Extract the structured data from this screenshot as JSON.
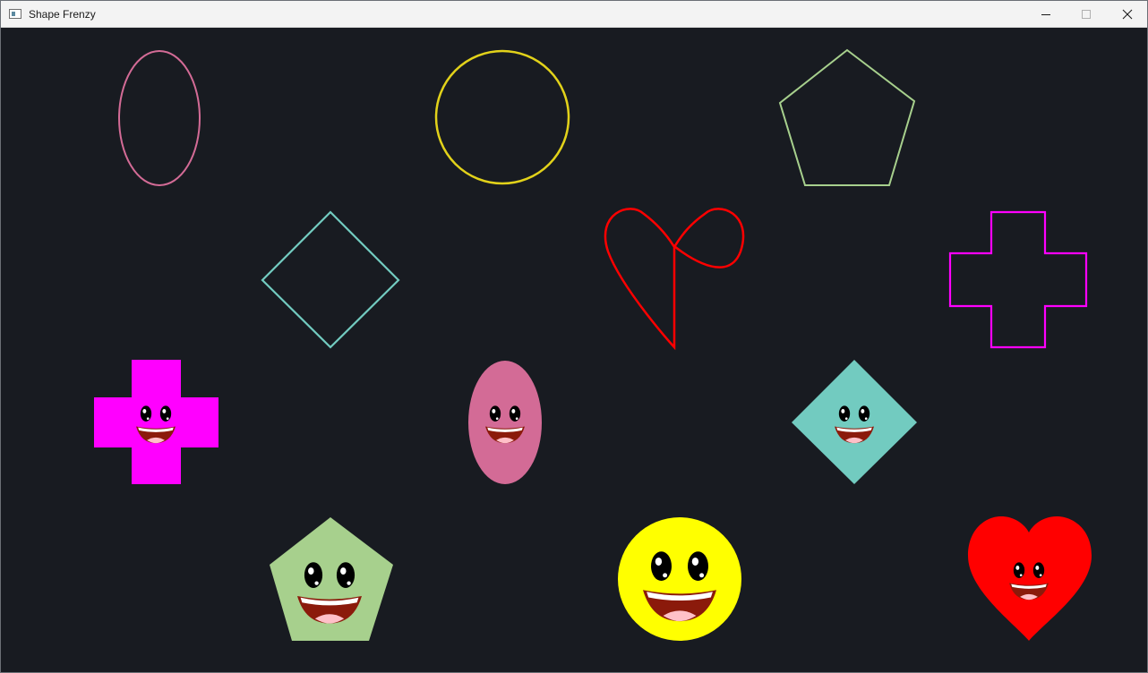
{
  "window": {
    "title": "Shape Frenzy",
    "app_icon": "window-app-icon",
    "controls": [
      "minimize-icon",
      "maximize-icon",
      "close-icon"
    ]
  },
  "colors": {
    "background": "#181b21",
    "pink": "#d36b96",
    "yellow": "#ffff00",
    "outline_yellow": "#e2d21a",
    "green": "#a7d08d",
    "teal": "#72cbc0",
    "red": "#ff0000",
    "magenta": "#ff00ff",
    "mouth": "#8b1a0b",
    "tongue": "#ffc0c8"
  },
  "outline_shapes": [
    {
      "shape": "ellipse",
      "color": "pink"
    },
    {
      "shape": "circle",
      "color": "outline_yellow"
    },
    {
      "shape": "pentagon",
      "color": "green"
    },
    {
      "shape": "diamond",
      "color": "teal"
    },
    {
      "shape": "heart",
      "color": "red"
    },
    {
      "shape": "cross",
      "color": "magenta"
    }
  ],
  "filled_shapes": [
    {
      "shape": "cross",
      "color": "magenta",
      "face": "smiley"
    },
    {
      "shape": "ellipse",
      "color": "pink",
      "face": "smiley"
    },
    {
      "shape": "diamond",
      "color": "teal",
      "face": "smiley"
    },
    {
      "shape": "pentagon",
      "color": "green",
      "face": "smiley"
    },
    {
      "shape": "circle",
      "color": "yellow",
      "face": "smiley"
    },
    {
      "shape": "heart",
      "color": "red",
      "face": "smiley"
    }
  ]
}
